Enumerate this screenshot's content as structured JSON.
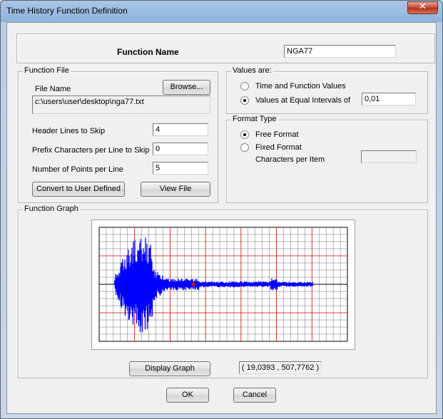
{
  "window": {
    "title": "Time History  Function Definition"
  },
  "function_name": {
    "label": "Function Name",
    "value": "NGA77"
  },
  "function_file": {
    "group_label": "Function File",
    "file_name_label": "File Name",
    "browse_label": "Browse...",
    "file_path": "c:\\users\\user\\desktop\\nga77.txt",
    "header_lines_label": "Header Lines to Skip",
    "header_lines_value": "4",
    "prefix_chars_label": "Prefix Characters per Line to Skip",
    "prefix_chars_value": "0",
    "points_per_line_label": "Number of Points per Line",
    "points_per_line_value": "5",
    "convert_label": "Convert to User Defined",
    "view_file_label": "View File"
  },
  "values_are": {
    "group_label": "Values are:",
    "time_function_label": "Time and Function Values",
    "equal_intervals_label": "Values at Equal Intervals of",
    "interval_value": "0,01",
    "selected": "equal_intervals"
  },
  "format_type": {
    "group_label": "Format Type",
    "free_label": "Free Format",
    "fixed_label": "Fixed Format",
    "chars_per_item_label": "Characters per Item",
    "chars_per_item_value": "",
    "selected": "free"
  },
  "function_graph": {
    "group_label": "Function Graph",
    "display_label": "Display Graph",
    "coord_readout": "( 19,0393  ,  507,7762 )",
    "colors": {
      "signal": "#0000ff",
      "major_grid": "#d00000",
      "minor_grid": "#000000",
      "marker": "#ff0000"
    }
  },
  "footer": {
    "ok_label": "OK",
    "cancel_label": "Cancel"
  }
}
